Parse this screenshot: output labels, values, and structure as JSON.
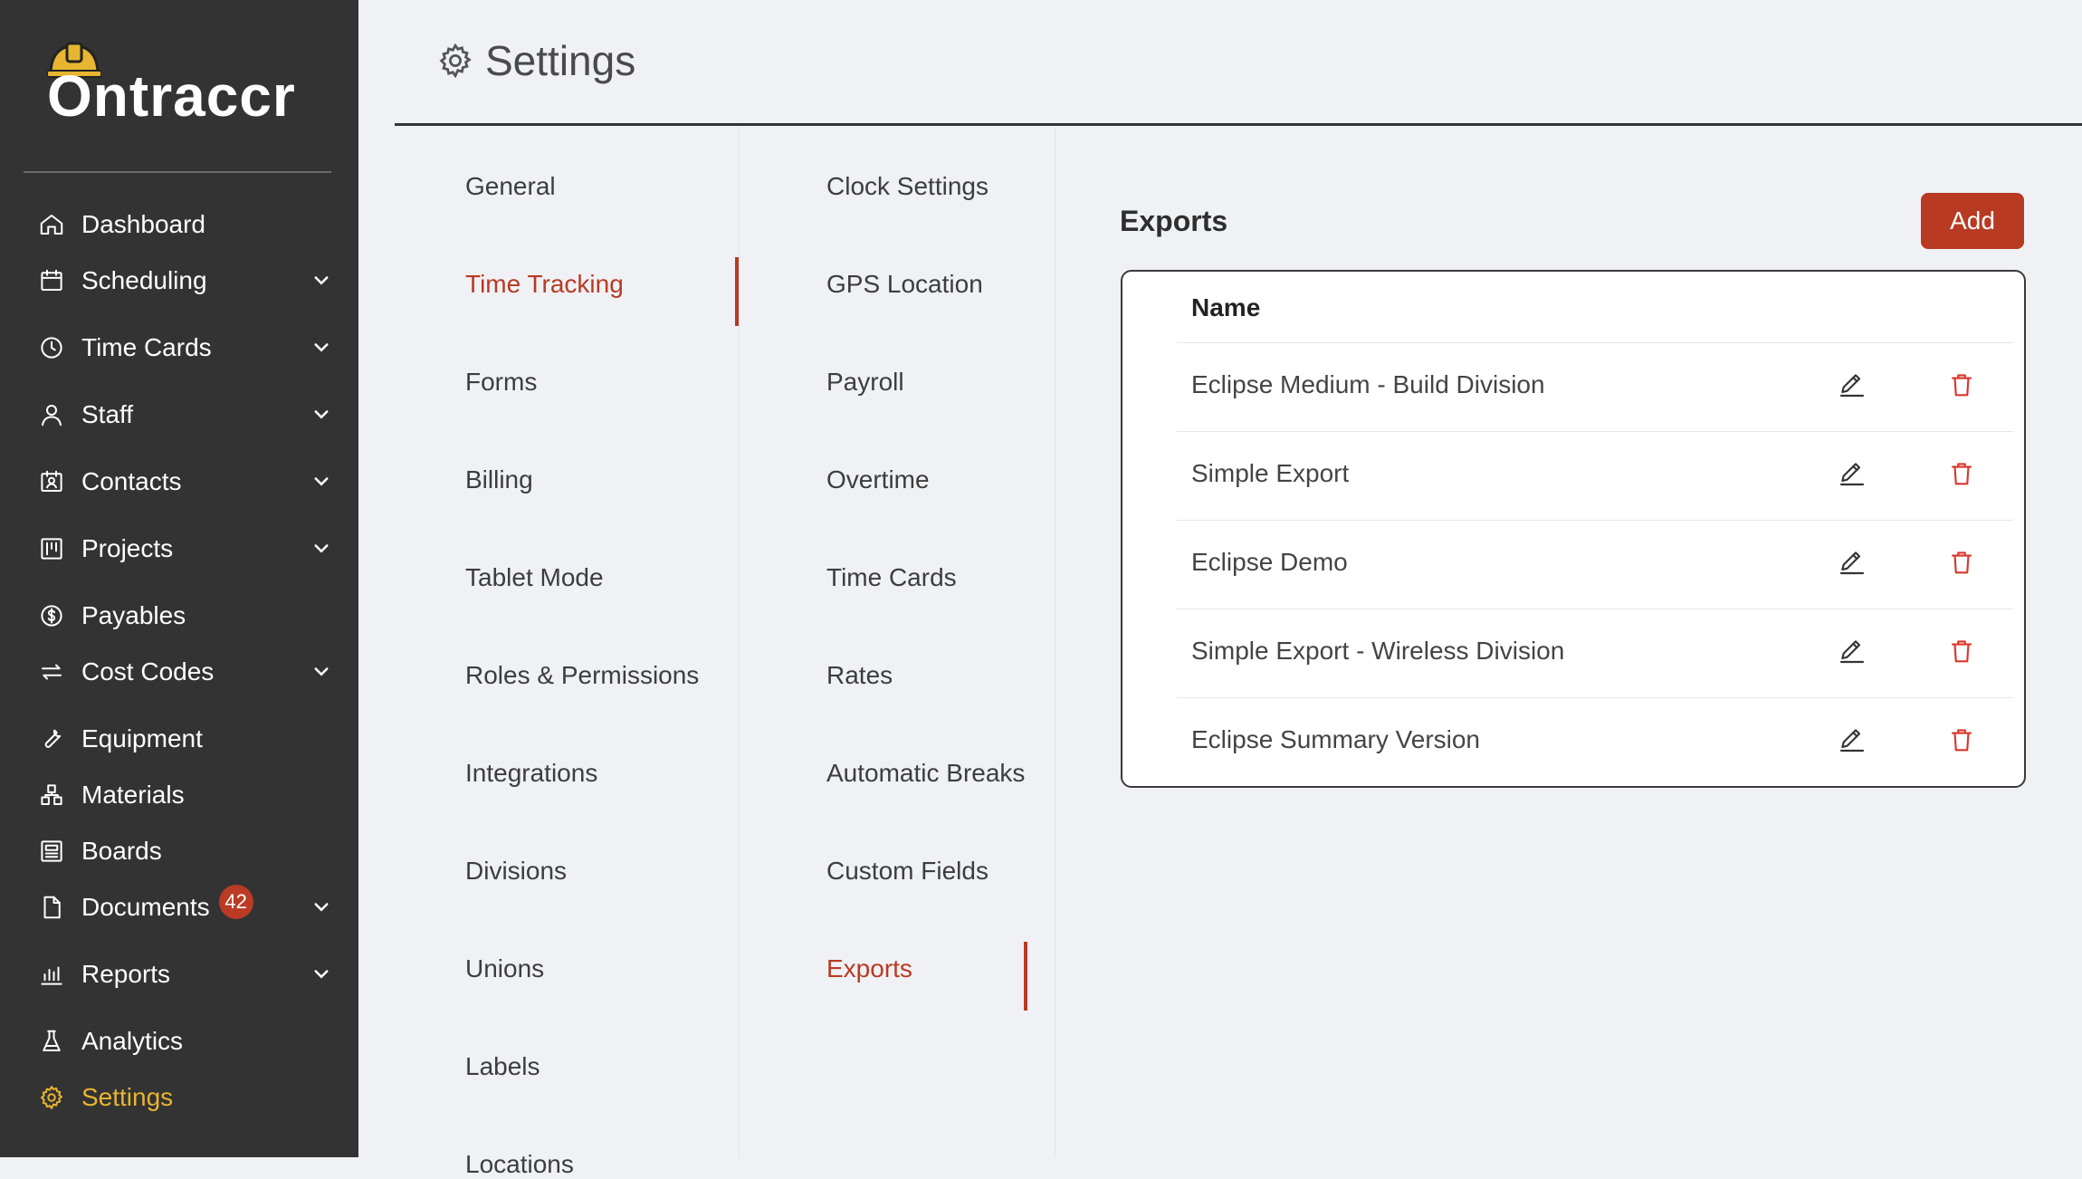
{
  "app": {
    "logo_text": "Ontraccr"
  },
  "sidebar": {
    "items": [
      {
        "label": "Dashboard",
        "icon": "home-icon",
        "expandable": false
      },
      {
        "label": "Scheduling",
        "icon": "calendar-icon",
        "expandable": true
      },
      {
        "label": "Time Cards",
        "icon": "clock-icon",
        "expandable": true
      },
      {
        "label": "Staff",
        "icon": "user-icon",
        "expandable": true
      },
      {
        "label": "Contacts",
        "icon": "contacts-icon",
        "expandable": true
      },
      {
        "label": "Projects",
        "icon": "projects-icon",
        "expandable": true
      },
      {
        "label": "Payables",
        "icon": "dollar-icon",
        "expandable": false
      },
      {
        "label": "Cost Codes",
        "icon": "swap-icon",
        "expandable": true
      },
      {
        "label": "Equipment",
        "icon": "wrench-icon",
        "expandable": false
      },
      {
        "label": "Materials",
        "icon": "materials-icon",
        "expandable": false
      },
      {
        "label": "Boards",
        "icon": "boards-icon",
        "expandable": false
      },
      {
        "label": "Documents",
        "icon": "document-icon",
        "expandable": true,
        "badge": "42"
      },
      {
        "label": "Reports",
        "icon": "bar-chart-icon",
        "expandable": true
      },
      {
        "label": "Analytics",
        "icon": "flask-icon",
        "expandable": false
      },
      {
        "label": "Settings",
        "icon": "gear-icon",
        "expandable": false,
        "active": true
      }
    ]
  },
  "header": {
    "title": "Settings"
  },
  "settings_menu": {
    "column1": [
      "General",
      "Time Tracking",
      "Forms",
      "Billing",
      "Tablet Mode",
      "Roles & Permissions",
      "Integrations",
      "Divisions",
      "Unions",
      "Labels",
      "Locations"
    ],
    "column1_selected": "Time Tracking",
    "column2": [
      "Clock Settings",
      "GPS Location",
      "Payroll",
      "Overtime",
      "Time Cards",
      "Rates",
      "Automatic Breaks",
      "Custom Fields",
      "Exports"
    ],
    "column2_selected": "Exports"
  },
  "exports": {
    "title": "Exports",
    "add_label": "Add",
    "column_header": "Name",
    "rows": [
      {
        "name": "Eclipse Medium - Build Division"
      },
      {
        "name": "Simple Export"
      },
      {
        "name": "Eclipse Demo"
      },
      {
        "name": "Simple Export - Wireless Division"
      },
      {
        "name": "Eclipse Summary Version"
      }
    ]
  },
  "colors": {
    "sidebar_bg": "#333333",
    "accent": "#b83a22",
    "active_nav": "#e8b531",
    "page_bg": "#f0f1f5"
  }
}
